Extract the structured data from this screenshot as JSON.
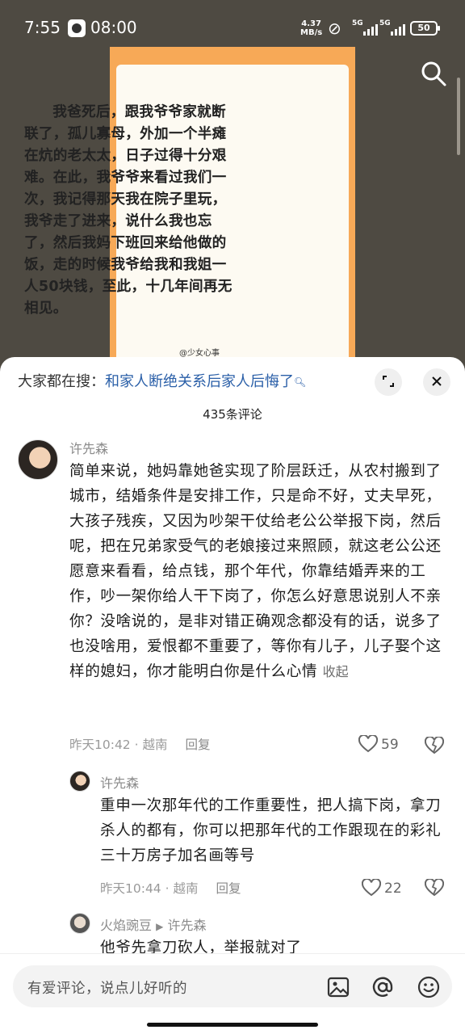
{
  "status_bar": {
    "time": "7:55",
    "clock_time": "08:00",
    "net_speed_value": "4.37",
    "net_speed_unit": "MB/s",
    "signal1": "5G",
    "signal2": "5G",
    "battery": "50"
  },
  "image": {
    "text": "我爸死后，跟我爷爷家就断联了，孤儿寡母，外加一个半瘫在炕的老太太，日子过得十分艰难。在此，我爷爷来看过我们一次，我记得那天我在院子里玩，我爷走了进来，说什么我也忘了，然后我妈下班回来给他做的饭，走的时候我爷给我和我姐一人50块钱，至此，十几年间再无相见。",
    "watermark": "@少女心事"
  },
  "sheet": {
    "search_label": "大家都在搜：",
    "search_query": "和家人断绝关系后家人后悔了",
    "comment_count": "435条评论"
  },
  "comments": [
    {
      "author": "许先森",
      "text": "简单来说，她妈靠她爸实现了阶层跃迁，从农村搬到了城市，结婚条件是安排工作，只是命不好，丈夫早死，大孩子残疾，又因为吵架干仗给老公公举报下岗，然后呢，把在兄弟家受气的老娘接过来照顾，就这老公公还愿意来看看，给点钱，那个年代，你靠结婚弄来的工作，吵一架你给人干下岗了，你怎么好意思说别人不亲你？没啥说的，是非对错正确观念都没有的话，说多了也没啥用，爱恨都不重要了，等你有儿子，儿子娶个这样的媳妇，你才能明白你是什么心情",
      "collapse": "收起",
      "time": "昨天10:42",
      "location": "越南",
      "reply": "回复",
      "likes": "59"
    },
    {
      "author": "许先森",
      "text": "重申一次那年代的工作重要性，把人搞下岗，拿刀杀人的都有，你可以把那年代的工作跟现在的彩礼三十万房子加名画等号",
      "time": "昨天10:44",
      "location": "越南",
      "reply": "回复",
      "likes": "22"
    },
    {
      "author": "火焰豌豆",
      "reply_arrow": "▶",
      "reply_to": "许先森",
      "text": "他爷先拿刀砍人，举报就对了"
    }
  ],
  "input": {
    "placeholder": "有爱评论，说点儿好听的"
  },
  "icons": [
    "search-icon",
    "expand-icon",
    "close-icon",
    "heart-icon",
    "dislike-heart-icon",
    "image-icon",
    "at-icon",
    "emoji-icon"
  ]
}
